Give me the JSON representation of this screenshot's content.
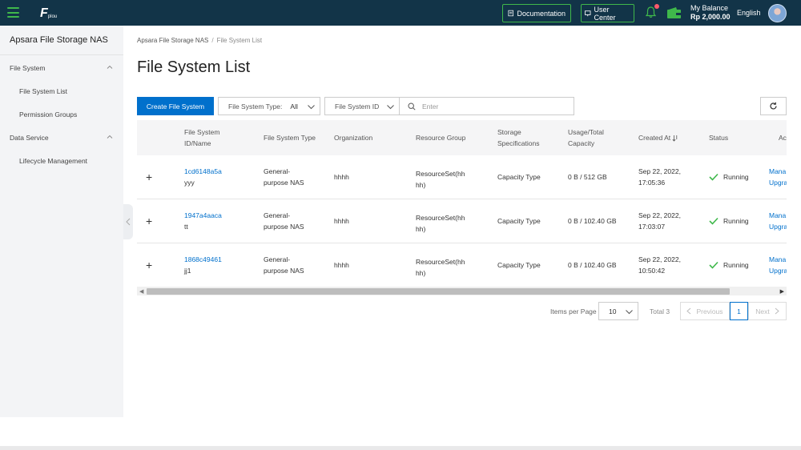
{
  "topbar": {
    "logo_mark": "F",
    "logo_text": "plou",
    "documentation_label": "Documentation",
    "user_center_label": "User Center",
    "balance_label": "My Balance",
    "balance_value": "Rp 2,000.00",
    "language": "English",
    "accent_color": "#3fb84b",
    "bg_color": "#123448"
  },
  "sidebar": {
    "title": "Apsara File Storage NAS",
    "groups": [
      {
        "label": "File System",
        "items": [
          {
            "label": "File System List"
          },
          {
            "label": "Permission Groups"
          }
        ]
      },
      {
        "label": "Data Service",
        "items": [
          {
            "label": "Lifecycle Management"
          }
        ]
      }
    ]
  },
  "breadcrumb": {
    "root": "Apsara File Storage NAS",
    "separator": "/",
    "current": "File System List"
  },
  "page": {
    "title": "File System List"
  },
  "toolbar": {
    "create_label": "Create File System",
    "type_filter_label": "File System Type:",
    "type_filter_value": "All",
    "id_filter_label": "File System ID",
    "search_placeholder": "Enter",
    "primary_color": "#0070cc"
  },
  "table": {
    "headers": {
      "id_name_1": "File System",
      "id_name_2": "ID/Name",
      "type": "File System Type",
      "org": "Organization",
      "resource_group": "Resource Group",
      "spec_1": "Storage",
      "spec_2": "Specifications",
      "usage_1": "Usage/Total",
      "usage_2": "Capacity",
      "created": "Created At",
      "status": "Status",
      "actions": "Ac"
    },
    "rows": [
      {
        "id": "1cd6148a5a",
        "name": "yyy",
        "type_1": "General-",
        "type_2": "purpose NAS",
        "org": "hhhh",
        "rg_1": "ResourceSet(hh",
        "rg_2": "hh)",
        "spec": "Capacity Type",
        "usage": "0 B / 512 GB",
        "created_1": "Sep 22, 2022,",
        "created_2": "17:05:36",
        "status": "Running",
        "action_1": "Mana",
        "action_2": "Upgra"
      },
      {
        "id": "1947a4aaca",
        "name": "tt",
        "type_1": "General-",
        "type_2": "purpose NAS",
        "org": "hhhh",
        "rg_1": "ResourceSet(hh",
        "rg_2": "hh)",
        "spec": "Capacity Type",
        "usage": "0 B / 102.40 GB",
        "created_1": "Sep 22, 2022,",
        "created_2": "17:03:07",
        "status": "Running",
        "action_1": "Mana",
        "action_2": "Upgra"
      },
      {
        "id": "1868c49461",
        "name": "jj1",
        "type_1": "General-",
        "type_2": "purpose NAS",
        "org": "hhhh",
        "rg_1": "ResourceSet(hh",
        "rg_2": "hh)",
        "spec": "Capacity Type",
        "usage": "0 B / 102.40 GB",
        "created_1": "Sep 22, 2022,",
        "created_2": "10:50:42",
        "status": "Running",
        "action_1": "Mana",
        "action_2": "Upgra"
      }
    ],
    "status_color": "#3fb84b"
  },
  "pagination": {
    "items_per_page_label": "Items per Page",
    "items_per_page": "10",
    "total_label": "Total 3",
    "previous_label": "Previous",
    "current_page": "1",
    "next_label": "Next"
  }
}
